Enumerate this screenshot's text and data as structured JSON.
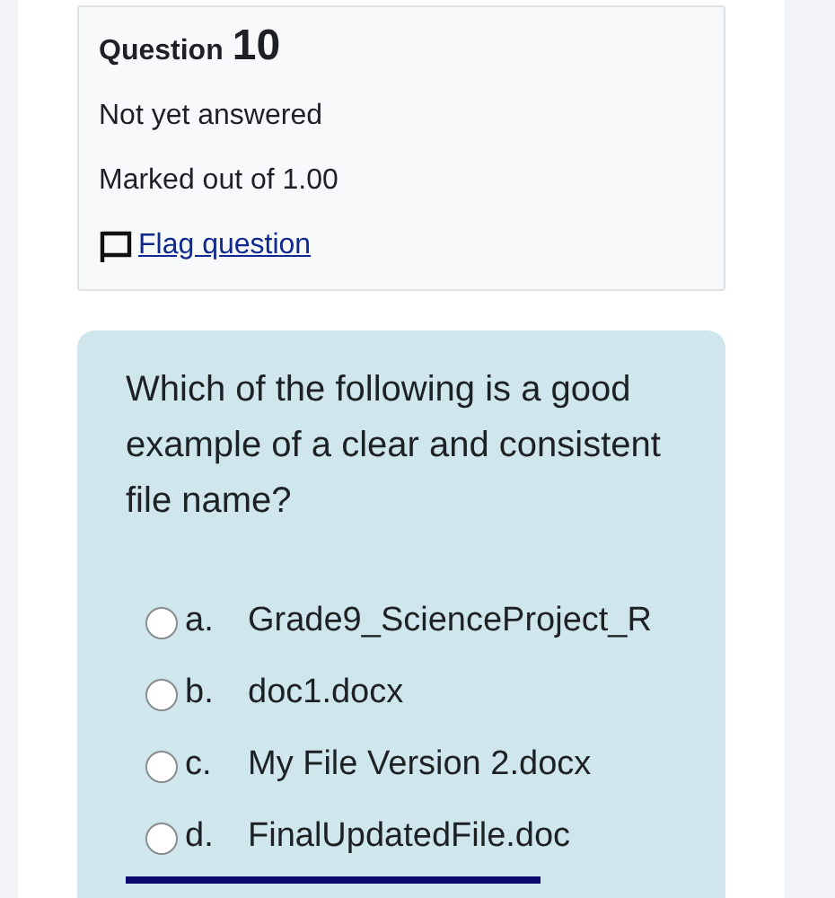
{
  "question_info": {
    "label": "Question",
    "number": "10",
    "status": "Not yet answered",
    "mark": "Marked out of 1.00",
    "flag": {
      "label": "Flag question",
      "flagged": false
    }
  },
  "question": {
    "text": "Which of the following is a good example of a clear and consistent file name?",
    "options": [
      {
        "letter": "a.",
        "text": "Grade9_ScienceProject_R",
        "selected": false
      },
      {
        "letter": "b.",
        "text": "doc1.docx",
        "selected": false
      },
      {
        "letter": "c.",
        "text": "My File Version 2.docx",
        "selected": false
      },
      {
        "letter": "d.",
        "text": "FinalUpdatedFile.doc",
        "selected": false
      }
    ]
  }
}
